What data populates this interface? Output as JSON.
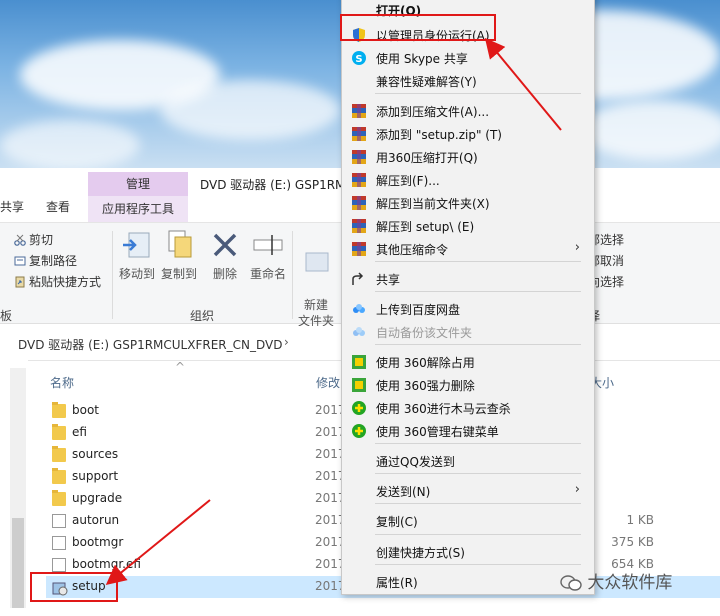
{
  "context_menu": {
    "items": [
      {
        "label": "打开(O)",
        "icon": "",
        "bold": true
      },
      {
        "label": "以管理员身份运行(A)",
        "icon": "uac-shield-icon"
      },
      {
        "label": "使用 Skype 共享",
        "icon": "skype-icon"
      },
      {
        "label": "兼容性疑难解答(Y)",
        "icon": ""
      },
      {
        "label": "添加到压缩文件(A)...",
        "icon": "winrar-icon"
      },
      {
        "label": "添加到 \"setup.zip\" (T)",
        "icon": "winrar-icon"
      },
      {
        "label": "用360压缩打开(Q)",
        "icon": "winrar-icon"
      },
      {
        "label": "解压到(F)...",
        "icon": "winrar-icon"
      },
      {
        "label": "解压到当前文件夹(X)",
        "icon": "winrar-icon"
      },
      {
        "label": "解压到 setup\\ (E)",
        "icon": "winrar-icon"
      },
      {
        "label": "其他压缩命令",
        "icon": "winrar-icon",
        "submenu": true
      },
      {
        "label": "共享",
        "icon": "share-icon"
      },
      {
        "label": "上传到百度网盘",
        "icon": "baidu-cloud-icon"
      },
      {
        "label": "自动备份该文件夹",
        "icon": "baidu-cloud-icon",
        "disabled": true
      },
      {
        "label": "使用 360解除占用",
        "icon": "360-icon"
      },
      {
        "label": "使用 360强力删除",
        "icon": "360-icon"
      },
      {
        "label": "使用 360进行木马云查杀",
        "icon": "360-plus-icon"
      },
      {
        "label": "使用 360管理右键菜单",
        "icon": "360-plus-icon"
      },
      {
        "label": "通过QQ发送到",
        "icon": ""
      },
      {
        "label": "发送到(N)",
        "icon": "",
        "submenu": true
      },
      {
        "label": "复制(C)",
        "icon": ""
      },
      {
        "label": "创建快捷方式(S)",
        "icon": ""
      },
      {
        "label": "属性(R)",
        "icon": ""
      }
    ],
    "submenu_arrow": "›"
  },
  "ribbon": {
    "tab_share": "共享",
    "tab_view": "查看",
    "manage_label": "管理",
    "app_tools_label": "应用程序工具",
    "window_title": "DVD 驱动器 (E:) GSP1RM",
    "cut": "剪切",
    "copy_path": "复制路径",
    "paste_shortcut": "粘贴快捷方式",
    "move_to": "移动到",
    "copy_to": "复制到",
    "delete": "删除",
    "rename": "重命名",
    "new_folder": "新建\n文件夹",
    "group_organize": "组织",
    "clipboard_partial": "板",
    "select_all": "部选择",
    "select_none": "部取消",
    "invert_selection": "向选择",
    "select_group": "择"
  },
  "address": {
    "path": "DVD 驱动器 (E:) GSP1RMCULXFRER_CN_DVD",
    "chevron": "›"
  },
  "columns": {
    "name": "名称",
    "modified": "修改",
    "size": "大小"
  },
  "files": [
    {
      "name": "boot",
      "date": "2017",
      "size": "",
      "type": "folder"
    },
    {
      "name": "efi",
      "date": "2017",
      "size": "",
      "type": "folder"
    },
    {
      "name": "sources",
      "date": "2017",
      "size": "",
      "type": "folder"
    },
    {
      "name": "support",
      "date": "2017",
      "size": "",
      "type": "folder"
    },
    {
      "name": "upgrade",
      "date": "2017",
      "size": "",
      "type": "folder"
    },
    {
      "name": "autorun",
      "date": "2017",
      "size": "1 KB",
      "type": "file"
    },
    {
      "name": "bootmgr",
      "date": "2017",
      "size": "375 KB",
      "type": "file"
    },
    {
      "name": "bootmgr.efi",
      "date": "2017",
      "size": "654 KB",
      "type": "file"
    },
    {
      "name": "setup",
      "date": "2017",
      "size": "",
      "type": "setup",
      "selected": true
    }
  ],
  "watermark": "大众软件库",
  "colors": {
    "annotation_red": "#e01818",
    "selection_blue": "#cce8ff",
    "manage_tab": "#e4cbee"
  }
}
